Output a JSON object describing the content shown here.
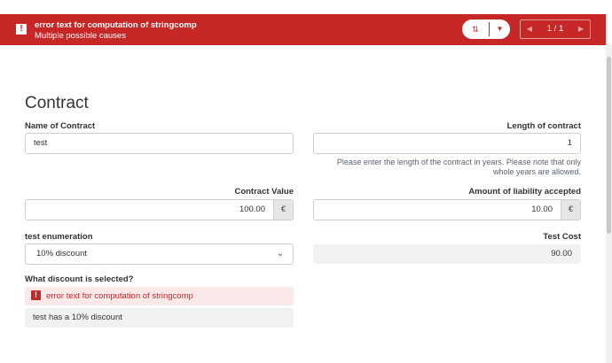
{
  "banner": {
    "title": "error text for computation of stringcomp",
    "subtitle": "Multiple possible causes",
    "icon": "error-icon",
    "sort_icon": "sort-updown-icon",
    "dropdown_icon": "chevron-down-icon",
    "pager_text": "1 / 1",
    "color": "#c62828"
  },
  "form": {
    "title": "Contract",
    "name_of_contract": {
      "label": "Name of Contract",
      "value": "test"
    },
    "length_of_contract": {
      "label": "Length of contract",
      "value": "1",
      "hint_line1": "Please enter the length of the contract in years. Please note that only",
      "hint_line2": "whole years are allowed."
    },
    "contract_value": {
      "label": "Contract Value",
      "value": "100.00",
      "suffix": "€"
    },
    "liability": {
      "label": "Amount of liability accepted",
      "value": "10.00",
      "suffix": "€"
    },
    "enumeration": {
      "label": "test enumeration",
      "value": "10% discount"
    },
    "test_cost": {
      "label": "Test Cost",
      "value": "90.00"
    },
    "discount": {
      "label": "What discount is selected?",
      "error": "error text for computation of stringcomp",
      "value": "test has a 10% discount"
    }
  }
}
